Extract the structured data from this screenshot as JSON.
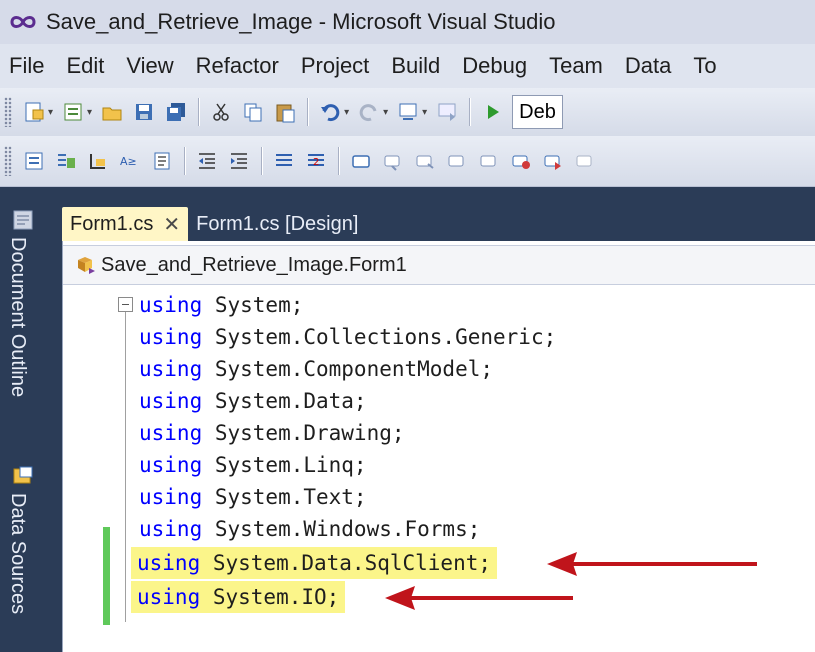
{
  "window": {
    "title": "Save_and_Retrieve_Image - Microsoft Visual Studio"
  },
  "menu": [
    "File",
    "Edit",
    "View",
    "Refactor",
    "Project",
    "Build",
    "Debug",
    "Team",
    "Data",
    "To"
  ],
  "toolbar": {
    "config_value": "Deb"
  },
  "side_panels": {
    "document_outline": "Document Outline",
    "data_sources": "Data Sources"
  },
  "tabs": [
    {
      "label": "Form1.cs",
      "active": true
    },
    {
      "label": "Form1.cs [Design]",
      "active": false
    }
  ],
  "tab_close_glyph": "✕",
  "navigation": {
    "class_label": "Save_and_Retrieve_Image.Form1"
  },
  "code_lines": [
    {
      "keyword": "using",
      "text": " System;",
      "highlight": false
    },
    {
      "keyword": "using",
      "text": " System.Collections.Generic;",
      "highlight": false
    },
    {
      "keyword": "using",
      "text": " System.ComponentModel;",
      "highlight": false
    },
    {
      "keyword": "using",
      "text": " System.Data;",
      "highlight": false
    },
    {
      "keyword": "using",
      "text": " System.Drawing;",
      "highlight": false
    },
    {
      "keyword": "using",
      "text": " System.Linq;",
      "highlight": false
    },
    {
      "keyword": "using",
      "text": " System.Text;",
      "highlight": false
    },
    {
      "keyword": "using",
      "text": " System.Windows.Forms;",
      "highlight": false
    },
    {
      "keyword": "using",
      "text": " System.Data.SqlClient;",
      "highlight": true
    },
    {
      "keyword": "using",
      "text": " System.IO;",
      "highlight": true
    }
  ],
  "colors": {
    "keyword": "#0000ff",
    "highlight": "#fbf58a",
    "arrow": "#c0141b",
    "change_bar": "#5fc95a",
    "frame": "#2b3c57"
  }
}
